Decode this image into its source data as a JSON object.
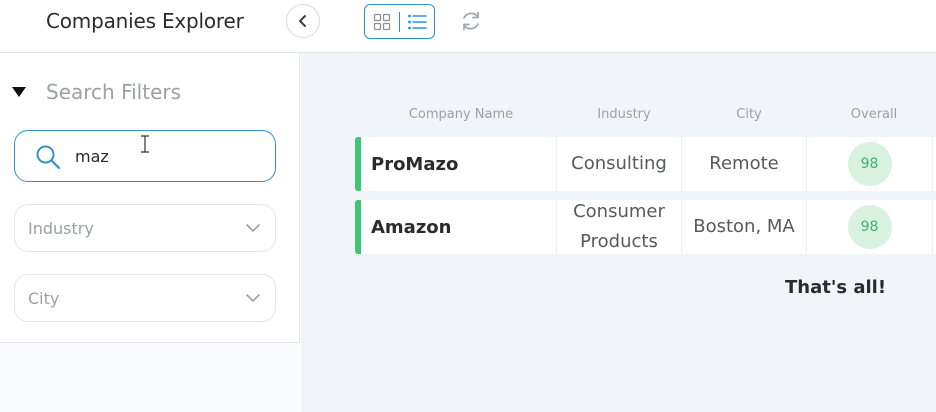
{
  "header": {
    "title": "Companies Explorer"
  },
  "filters": {
    "title": "Search Filters",
    "search_value": "maz",
    "industry_placeholder": "Industry",
    "city_placeholder": "City"
  },
  "table": {
    "columns": [
      "Company Name",
      "Industry",
      "City",
      "Overall"
    ],
    "rows": [
      {
        "name": "ProMazo",
        "industry": "Consulting",
        "city": "Remote",
        "overall": "98"
      },
      {
        "name": "Amazon",
        "industry": "Consumer Products",
        "city": "Boston, MA",
        "overall": "98"
      }
    ],
    "end_message": "That's all!"
  },
  "colors": {
    "accent": "#2f93c9",
    "row_accent": "#3cc775",
    "score_bg": "#d8f1e1",
    "score_text": "#3cb46a"
  },
  "icons": {
    "collapse": "chevron-left-icon",
    "grid_view": "grid-icon",
    "list_view": "list-icon",
    "refresh": "refresh-icon",
    "filters_toggle": "caret-down-icon",
    "search": "search-icon",
    "select_chevron": "chevron-down-icon"
  }
}
